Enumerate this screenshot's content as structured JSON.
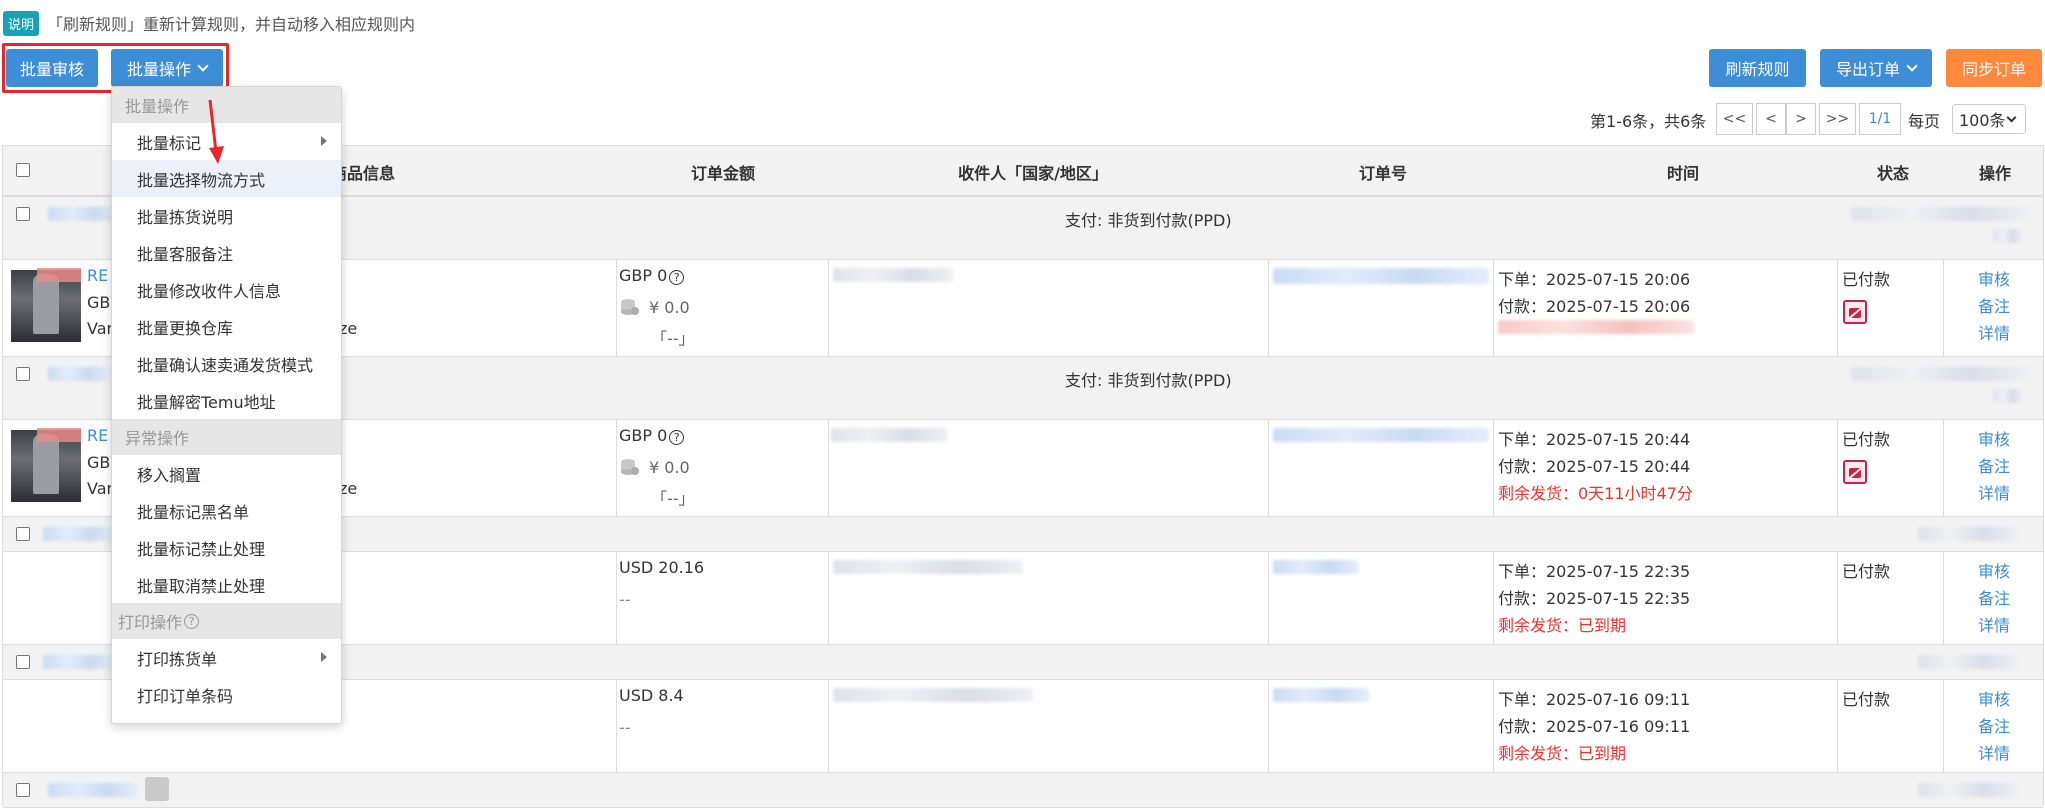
{
  "notice": {
    "tag": "说明",
    "text": "「刷新规则」重新计算规则，并自动移入相应规则内"
  },
  "toolbar": {
    "batch_review": "批量审核",
    "batch_ops": "批量操作",
    "refresh_rules": "刷新规则",
    "export_orders": "导出订单",
    "sync_orders": "同步订单"
  },
  "pager": {
    "info": "第1-6条，共6条",
    "first": "<<",
    "prev": "<",
    "next": ">",
    "last": ">>",
    "page": "1/1",
    "per_page_label": "每页",
    "per_page_value": "100条"
  },
  "table": {
    "headers": [
      "商品信息",
      "订单金额",
      "收件人「国家/地区」",
      "订单号",
      "时间",
      "状态",
      "操作"
    ],
    "payment_label": "支付: 非货到付款(PPD)",
    "rows": [
      {
        "product_title": "RE",
        "product_line2": "GBP",
        "product_line3": "Vari",
        "product_size": "ze",
        "amount": "GBP 0",
        "cost": "¥ 0.0",
        "cost_note": "「--」",
        "time_order": "下单：2025-07-15 20:06",
        "time_paid": "付款：2025-07-15 20:06",
        "status": "已付款",
        "actions": [
          "审核",
          "备注",
          "详情"
        ]
      },
      {
        "product_title": "RE",
        "product_line2": "GBP",
        "product_line3": "Vari",
        "product_size": "ze",
        "amount": "GBP 0",
        "cost": "¥ 0.0",
        "cost_note": "「--」",
        "time_order": "下单：2025-07-15 20:44",
        "time_paid": "付款：2025-07-15 20:44",
        "remaining": "剩余发货：0天11小时47分",
        "status": "已付款",
        "actions": [
          "审核",
          "备注",
          "详情"
        ]
      },
      {
        "amount": "USD 20.16",
        "amount_note": "--",
        "time_order": "下单：2025-07-15 22:35",
        "time_paid": "付款：2025-07-15 22:35",
        "remaining": "剩余发货：已到期",
        "status": "已付款",
        "actions": [
          "审核",
          "备注",
          "详情"
        ]
      },
      {
        "amount": "USD 8.4",
        "amount_note": "--",
        "time_order": "下单：2025-07-16 09:11",
        "time_paid": "付款：2025-07-16 09:11",
        "remaining": "剩余发货：已到期",
        "status": "已付款",
        "actions": [
          "审核",
          "备注",
          "详情"
        ]
      }
    ]
  },
  "menu": {
    "section_batch": "批量操作",
    "batch_items": [
      "批量标记",
      "批量选择物流方式",
      "批量拣货说明",
      "批量客服备注",
      "批量修改收件人信息",
      "批量更换仓库",
      "批量确认速卖通发货模式",
      "批量解密Temu地址"
    ],
    "section_exception": "异常操作",
    "exception_items": [
      "移入搁置",
      "批量标记黑名单",
      "批量标记禁止处理",
      "批量取消禁止处理"
    ],
    "section_print": "打印操作",
    "print_items": [
      "打印拣货单",
      "打印订单条码"
    ]
  },
  "colors": {
    "primary": "#3d8ed6",
    "orange": "#ff8a3d",
    "highlight_red": "#e6272d",
    "teal": "#17a2b8"
  }
}
